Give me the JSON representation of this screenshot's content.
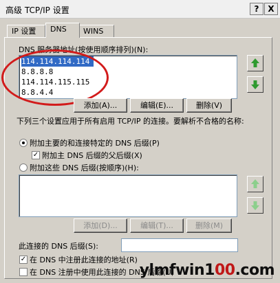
{
  "window": {
    "title": "高级 TCP/IP 设置",
    "help_button": "?",
    "close_button": "X"
  },
  "tabs": [
    {
      "label": "IP 设置"
    },
    {
      "label": "DNS"
    },
    {
      "label": "WINS"
    }
  ],
  "dns_servers": {
    "label": "DNS 服务器地址(按使用顺序排列)(N):",
    "items": [
      "114.114.114.114",
      "8.8.8.8",
      "114.114.115.115",
      "8.8.4.4"
    ],
    "buttons": {
      "add": "添加(A)...",
      "edit": "编辑(E)...",
      "remove": "删除(V)"
    }
  },
  "description": "下列三个设置应用于所有启用 TCP/IP 的连接。要解析不合格的名称:",
  "suffix_options": {
    "primary_label": "附加主要的和连接特定的 DNS 后缀(P)",
    "parent_label": "附加主 DNS 后缀的父后缀(X)",
    "these_label": "附加这些 DNS 后缀(按顺序)(H):"
  },
  "suffix_buttons": {
    "add": "添加(D)...",
    "edit": "编辑(T)...",
    "remove": "删除(M)"
  },
  "connection_suffix": {
    "label": "此连接的 DNS 后缀(S):",
    "value": ""
  },
  "checkboxes": {
    "register": "在 DNS 中注册此连接的地址(R)",
    "use_suffix": "在 DNS 注册中使用此连接的 DNS 后缀(U)"
  },
  "watermark": {
    "part1": "ylmfwin1",
    "part2": "00",
    "part3": ".com"
  },
  "colors": {
    "accent": "#316ac5",
    "annotation": "#d21b1b",
    "arrow": "#2f9a2f"
  }
}
